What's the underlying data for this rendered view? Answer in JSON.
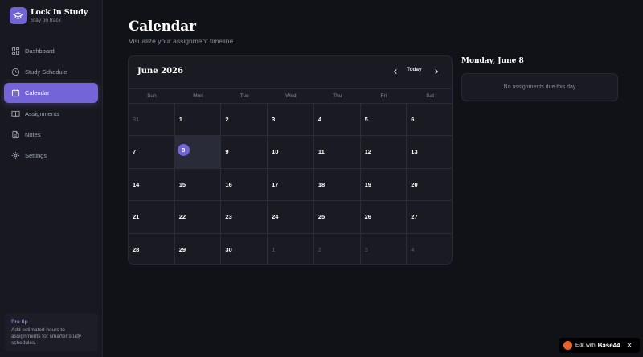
{
  "app": {
    "name": "Lock In Study",
    "tagline": "Stay on track"
  },
  "sidebar": {
    "items": [
      {
        "label": "Dashboard",
        "icon": "dashboard-icon"
      },
      {
        "label": "Study Schedule",
        "icon": "clock-icon"
      },
      {
        "label": "Calendar",
        "icon": "calendar-icon",
        "active": true
      },
      {
        "label": "Assignments",
        "icon": "book-icon"
      },
      {
        "label": "Notes",
        "icon": "file-icon"
      },
      {
        "label": "Settings",
        "icon": "gear-icon"
      }
    ],
    "protip": {
      "title": "Pro tip",
      "text": "Add estimated hours to assignments for smarter study schedules."
    }
  },
  "page": {
    "title": "Calendar",
    "subtitle": "Visualize your assignment timeline"
  },
  "calendar": {
    "month_label": "June 2026",
    "today_label": "Today",
    "weekdays": [
      "Sun",
      "Mon",
      "Tue",
      "Wed",
      "Thu",
      "Fri",
      "Sat"
    ],
    "days": [
      {
        "n": "31",
        "other": true
      },
      {
        "n": "1"
      },
      {
        "n": "2"
      },
      {
        "n": "3"
      },
      {
        "n": "4"
      },
      {
        "n": "5"
      },
      {
        "n": "6"
      },
      {
        "n": "7"
      },
      {
        "n": "8",
        "selected": true
      },
      {
        "n": "9"
      },
      {
        "n": "10"
      },
      {
        "n": "11"
      },
      {
        "n": "12"
      },
      {
        "n": "13"
      },
      {
        "n": "14"
      },
      {
        "n": "15"
      },
      {
        "n": "16"
      },
      {
        "n": "17"
      },
      {
        "n": "18"
      },
      {
        "n": "19"
      },
      {
        "n": "20"
      },
      {
        "n": "21"
      },
      {
        "n": "22"
      },
      {
        "n": "23"
      },
      {
        "n": "24"
      },
      {
        "n": "25"
      },
      {
        "n": "26"
      },
      {
        "n": "27"
      },
      {
        "n": "28"
      },
      {
        "n": "29"
      },
      {
        "n": "30"
      },
      {
        "n": "1",
        "other": true
      },
      {
        "n": "2",
        "other": true
      },
      {
        "n": "3",
        "other": true
      },
      {
        "n": "4",
        "other": true
      }
    ]
  },
  "day_panel": {
    "title": "Monday, June 8",
    "empty_text": "No assignments due this day"
  },
  "badge": {
    "prefix": "Edit with",
    "brand": "Base44",
    "close": "✕"
  },
  "colors": {
    "accent": "#7365d8",
    "background": "#111217",
    "panel": "#1a1b22"
  }
}
